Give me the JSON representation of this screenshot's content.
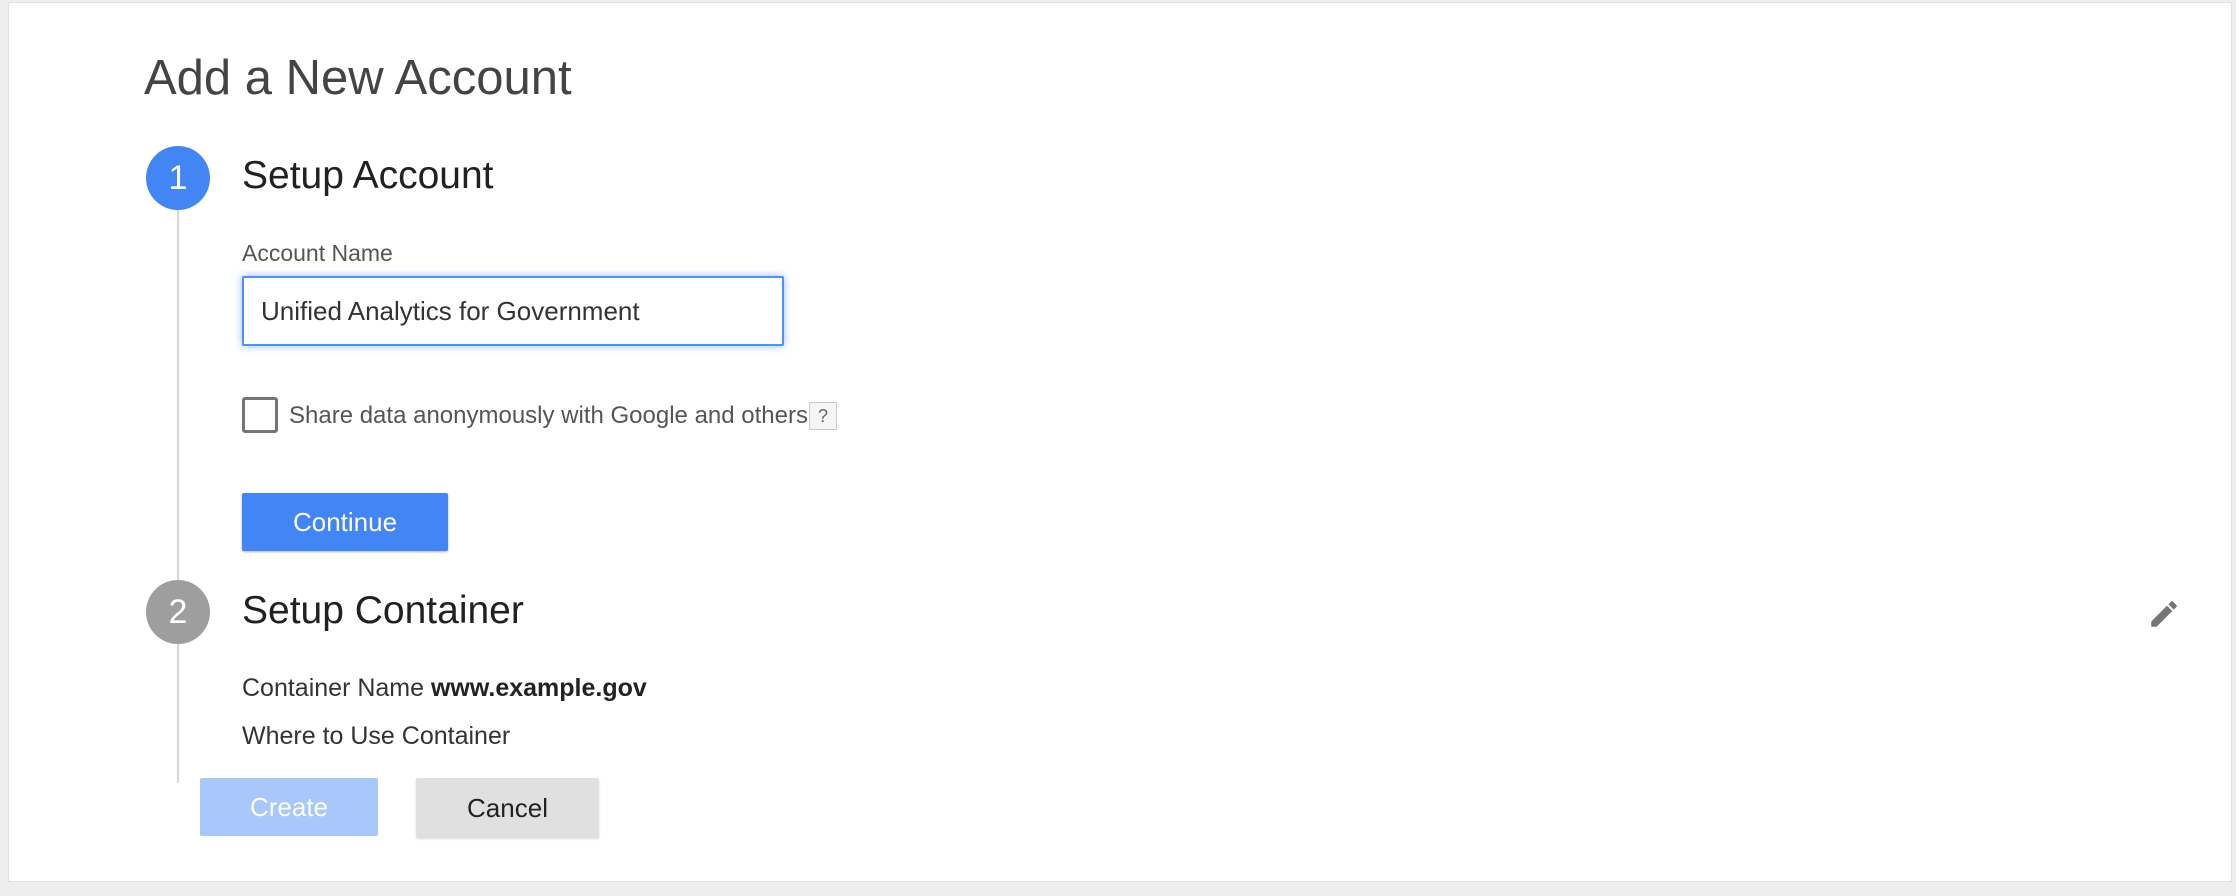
{
  "page": {
    "title": "Add a New Account"
  },
  "steps": [
    {
      "number": "1",
      "title": "Setup Account",
      "state": "active",
      "color": "#4285f4"
    },
    {
      "number": "2",
      "title": "Setup Container",
      "state": "inactive",
      "color": "#9e9e9e"
    }
  ],
  "account": {
    "name_label": "Account Name",
    "name_value": "Unified Analytics for Government",
    "share_label": "Share data anonymously with Google and others",
    "share_checked": false,
    "help_label": "?",
    "continue_label": "Continue"
  },
  "container": {
    "name_label": "Container Name",
    "name_value": "www.example.gov",
    "where_label": "Where to Use Container",
    "edit_icon": "pencil-icon"
  },
  "actions": {
    "create_label": "Create",
    "create_enabled": false,
    "cancel_label": "Cancel"
  },
  "colors": {
    "accent": "#4285f4",
    "accent_disabled": "#a8c7fa",
    "inactive": "#9e9e9e"
  }
}
